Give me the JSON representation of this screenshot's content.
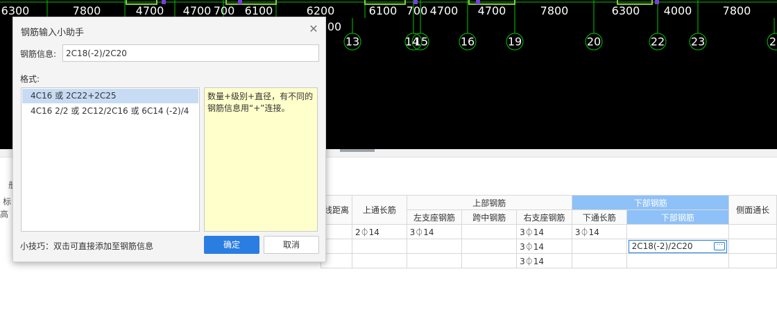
{
  "cad": {
    "dimensions": [
      "6300",
      "7800",
      "4700",
      "4700",
      "700",
      "6100",
      "6200",
      "6100",
      "700",
      "4700",
      "4700",
      "7800",
      "6300",
      "4000",
      "7800",
      "00"
    ],
    "axes": [
      "13",
      "14",
      "15",
      "16",
      "19",
      "20",
      "22",
      "23",
      "2"
    ]
  },
  "dialog": {
    "title": "钢筋输入小助手",
    "info_label": "钢筋信息:",
    "info_value": "2C18(-2)/2C20",
    "format_label": "格式:",
    "formats": [
      "4C16 或 2C22+2C25",
      "4C16 2/2 或 2C12/2C16 或 6C14 (-2)/4"
    ],
    "description": "数量+级别+直径，有不同的钢筋信息用“+”连接。",
    "tip": "小技巧：双击可直接添加至钢筋信息",
    "ok_label": "确定",
    "cancel_label": "取消"
  },
  "sidebar_glyphs": {
    "a": "册",
    "b": "标",
    "c": "高"
  },
  "table": {
    "header_top": {
      "dist": "线距离",
      "top_through": "上通长筋",
      "upper_group": "上部钢筋",
      "lower_group": "下部钢筋",
      "side": "侧面通长"
    },
    "header_sub": {
      "left_support": "左支座钢筋",
      "mid_span": "跨中钢筋",
      "right_support": "右支座钢筋",
      "bottom_through": "下通长筋",
      "bottom_rebar": "下部钢筋"
    },
    "rows": [
      {
        "top_through": "2⏀14",
        "left_support": "3⏀14",
        "mid_span": "",
        "right_support": "3⏀14",
        "bottom_through": "3⏀14",
        "bottom_rebar": ""
      },
      {
        "top_through": "",
        "left_support": "",
        "mid_span": "",
        "right_support": "3⏀14",
        "bottom_through": "",
        "bottom_rebar": "2C18(-2)/2C20"
      },
      {
        "top_through": "",
        "left_support": "",
        "mid_span": "",
        "right_support": "3⏀14",
        "bottom_through": "",
        "bottom_rebar": ""
      }
    ],
    "editor_button": "···"
  },
  "colors": {
    "cad_bg": "#000000",
    "cad_line": "#00c800",
    "header_highlight": "#8ec1f7",
    "primary_button": "#2a7de1",
    "description_bg": "#ffffcc"
  }
}
